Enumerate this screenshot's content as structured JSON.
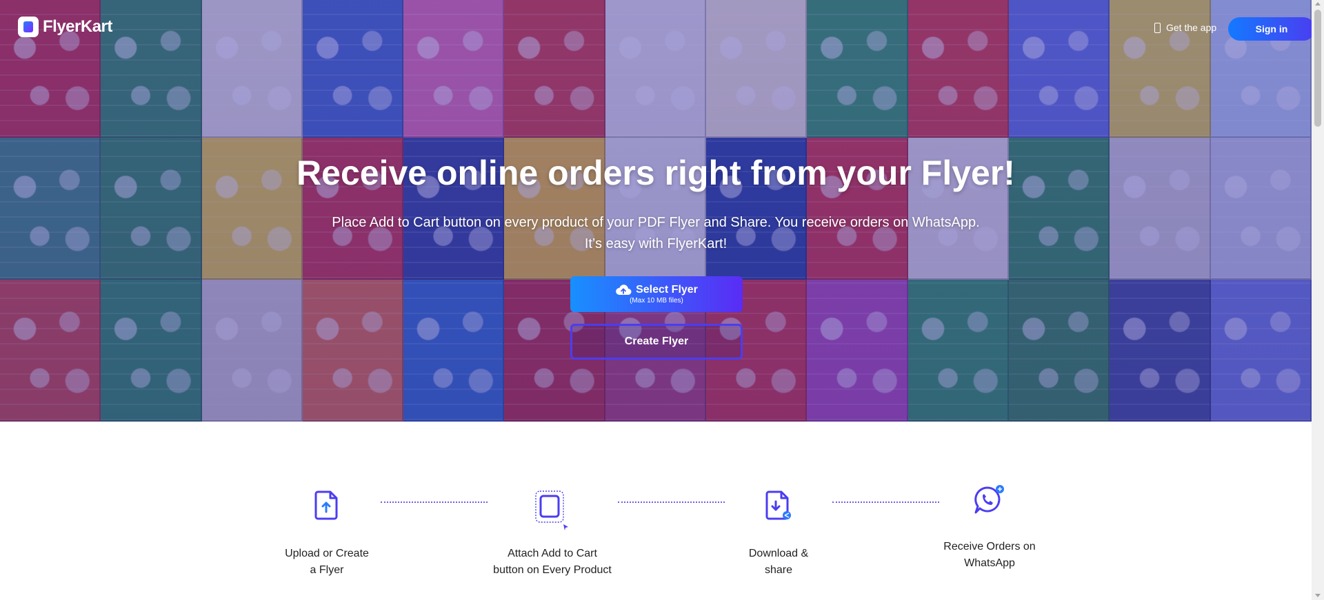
{
  "brand": {
    "logo_text": "FlyerKart"
  },
  "header": {
    "get_app_label": "Get the app",
    "signin_label": "Sign in"
  },
  "hero": {
    "title": "Receive online orders right from your Flyer!",
    "subtitle_line1": "Place Add to Cart button on every product of your PDF Flyer and Share. You receive orders on WhatsApp.",
    "subtitle_line2": "It’s easy with FlyerKart!",
    "select_label": "Select Flyer",
    "select_note": "(Max 10 MB files)",
    "create_label": "Create Flyer",
    "tile_colors": [
      "#c82a2e",
      "#2e8b4a",
      "#e7e3d4",
      "#3b64c0",
      "#e46aa0",
      "#d4362c",
      "#e8e6e0",
      "#f2e8cc",
      "#2e9a4e",
      "#d8352a",
      "#5b6fd6",
      "#e6d038",
      "#b9d0e8",
      "#3a8a6a",
      "#2c8a48",
      "#f0d02c",
      "#d12e2f",
      "#2a3f8e",
      "#f4c21e",
      "#e8e8e0",
      "#1f3f8f",
      "#d8302c",
      "#e9e4d8",
      "#2a8f44",
      "#d4d2cc",
      "#c8d0e0",
      "#d2452e",
      "#29904c",
      "#d8d0c4",
      "#ea6a30",
      "#2a6cc4",
      "#c0262a",
      "#b73b5e",
      "#d62e2e",
      "#b648a8",
      "#2a9a4a",
      "#2b8a3e",
      "#3a4a8c",
      "#6a7ad8"
    ],
    "icons": [
      "cloud-upload-icon"
    ]
  },
  "steps": [
    {
      "label_line1": "Upload or Create",
      "label_line2": "a Flyer",
      "icon": "upload-file-icon"
    },
    {
      "label_line1": "Attach Add to Cart",
      "label_line2": "button on Every Product",
      "icon": "select-cursor-icon"
    },
    {
      "label_line1": "Download &",
      "label_line2": "share",
      "icon": "download-share-icon"
    },
    {
      "label_line1": "Receive Orders on",
      "label_line2": "WhatsApp",
      "icon": "whatsapp-icon"
    }
  ],
  "colors": {
    "accent_blue": "#1479ff",
    "accent_purple": "#5a2cf5",
    "step_icon": "#4b3df0",
    "text_dark": "#222222"
  }
}
